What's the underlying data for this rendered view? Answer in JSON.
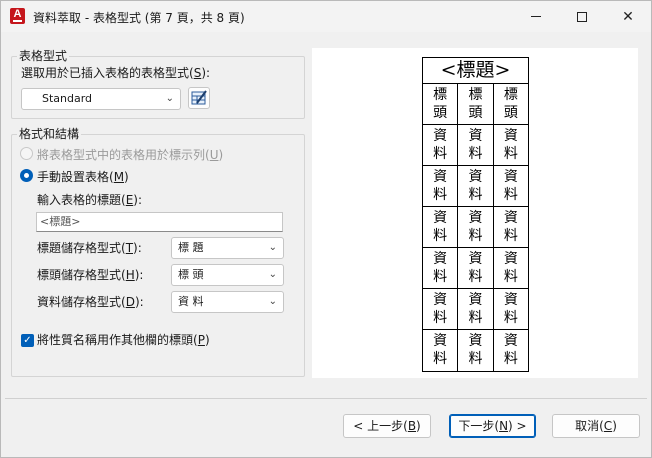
{
  "window": {
    "title": "資料萃取 - 表格型式 (第 7 頁，共 8 頁)",
    "app_icon_letter": "A"
  },
  "table_style_group": {
    "title": "表格型式",
    "prompt": "選取用於已插入表格的表格型式(",
    "prompt_key": "S",
    "prompt_end": "):",
    "selected_style": "Standard"
  },
  "format_group": {
    "title": "格式和結構",
    "radio_use_style": {
      "label": "將表格型式中的表格用於標示列(",
      "key": "U",
      "end": ")"
    },
    "radio_manual": {
      "label": "手動設置表格(",
      "key": "M",
      "end": ")"
    },
    "title_prompt": {
      "label": "輸入表格的標題(",
      "key": "E",
      "end": "):"
    },
    "title_placeholder": "<標題>",
    "title_cell_style": {
      "label": "標題儲存格型式(",
      "key": "T",
      "end": "):",
      "value": "標 題"
    },
    "header_cell_style": {
      "label": "標頭儲存格型式(",
      "key": "H",
      "end": "):",
      "value": "標 頭"
    },
    "data_cell_style": {
      "label": "資料儲存格型式(",
      "key": "D",
      "end": "):",
      "value": "資 料"
    },
    "checkbox_prop_name": {
      "label": "將性質名稱用作其他欄的標頭(",
      "key": "P",
      "end": ")",
      "checked": true
    }
  },
  "preview": {
    "title": "<標題>",
    "header_cell": "標頭",
    "data_cell": "資料",
    "columns": 3,
    "data_rows": 6
  },
  "buttons": {
    "back": {
      "label": "< 上一步(",
      "key": "B",
      "end": ")"
    },
    "next": {
      "label": "下一步(",
      "key": "N",
      "end": ") >"
    },
    "cancel": {
      "label": "取消(",
      "key": "C",
      "end": ")"
    }
  },
  "colors": {
    "accent": "#005fb8",
    "app_icon": "#c5161c"
  }
}
